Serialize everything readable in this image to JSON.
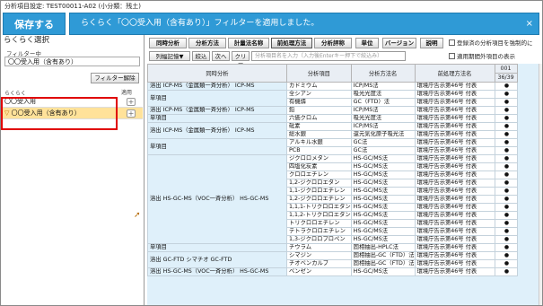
{
  "window_title": "分析項目設定: TEST00011-A02 (小分類：残土)",
  "save_label": "保存する",
  "banner_text": "らくらく「〇〇受入用（含有あり）」フィルターを適用しました。",
  "banner_close": "×",
  "left": {
    "heading": "らくらく選択",
    "filter_heading": "フィルター中",
    "filter_value": "〇〇受入用（含有あり）",
    "filter_clear_label": "フィルター解除",
    "list_heading": "らくらく",
    "apply_heading": "適用",
    "items": [
      {
        "label": "〇〇受入用",
        "prefix": ""
      },
      {
        "label": "〇〇受入用（含有あり）",
        "prefix": "▽"
      }
    ]
  },
  "tabs": [
    "同時分析",
    "分析方法",
    "計量法名称",
    "前処理方法",
    "分析評称",
    "単位",
    "バージョン",
    "説明"
  ],
  "options": {
    "sync_label": "登録済の分析項目を強制的に",
    "show_label": "適用期間外項目の表示"
  },
  "toolbar2": {
    "col_label": "列幅記憶",
    "col_arrow": "▼",
    "narrow": "絞込",
    "next": "次へ",
    "clear": "クリア",
    "search_placeholder": "分析項目名を入力（入力後Enterキー押下で絞込み）"
  },
  "table": {
    "headers": [
      "同時分析",
      "分析項目",
      "分析方法名",
      "前処理方法名",
      "001"
    ],
    "sub_header": "36/39",
    "rows": [
      {
        "group": "溶出 ICP-MS（金属類一斉分析） ICP-MS",
        "item": "カドミウム",
        "method": "ICP/MS法",
        "pre": "環境庁告示第46号 付表",
        "mark": "●"
      },
      {
        "group": "単項目",
        "item": "全シアン",
        "method": "吸光光度法",
        "pre": "環境庁告示第46号 付表",
        "mark": "●"
      },
      {
        "group": "",
        "item": "有機燐",
        "method": "GC（FTD）法",
        "pre": "環境庁告示第46号 付表",
        "mark": "●"
      },
      {
        "group": "溶出 ICP-MS（金属類一斉分析） ICP-MS",
        "item": "鉛",
        "method": "ICP/MS法",
        "pre": "環境庁告示第46号 付表",
        "mark": "●"
      },
      {
        "group": "単項目",
        "item": "六価クロム",
        "method": "吸光光度法",
        "pre": "環境庁告示第46号 付表",
        "mark": "●"
      },
      {
        "group": "溶出 ICP-MS（金属類一斉分析） ICP-MS",
        "item": "砒素",
        "method": "ICP/MS法",
        "pre": "環境庁告示第46号 付表",
        "mark": "●"
      },
      {
        "group": "",
        "item": "総水銀",
        "method": "還元気化原子吸光法",
        "pre": "環境庁告示第46号 付表",
        "mark": "●"
      },
      {
        "group": "単項目",
        "item": "アルキル水銀",
        "method": "GC法",
        "pre": "環境庁告示第46号 付表",
        "mark": "●"
      },
      {
        "group": "",
        "item": "PCB",
        "method": "GC法",
        "pre": "環境庁告示第46号 付表",
        "mark": "●"
      },
      {
        "group": "",
        "item": "ジクロロメタン",
        "method": "HS-GC/MS法",
        "pre": "環境庁告示第46号 付表",
        "mark": "●"
      },
      {
        "group": "",
        "item": "四塩化炭素",
        "method": "HS-GC/MS法",
        "pre": "環境庁告示第46号 付表",
        "mark": "●"
      },
      {
        "group": "",
        "item": "クロロエチレン",
        "method": "HS-GC/MS法",
        "pre": "環境庁告示第46号 付表",
        "mark": "●"
      },
      {
        "group": "",
        "item": "1,2-ジクロロエタン",
        "method": "HS-GC/MS法",
        "pre": "環境庁告示第46号 付表",
        "mark": "●"
      },
      {
        "group": "",
        "item": "1,1-ジクロロエチレン",
        "method": "HS-GC/MS法",
        "pre": "環境庁告示第46号 付表",
        "mark": "●"
      },
      {
        "group": "溶出 HS-GC-MS（VOC一斉分析） HS-GC-MS",
        "item": "1,2-ジクロロエチレン",
        "method": "HS-GC/MS法",
        "pre": "環境庁告示第46号 付表",
        "mark": "●"
      },
      {
        "group": "",
        "item": "1,1,1-トリクロロエタン",
        "method": "HS-GC/MS法",
        "pre": "環境庁告示第46号 付表",
        "mark": "●"
      },
      {
        "group": "",
        "item": "1,1,2-トリクロロエタン",
        "method": "HS-GC/MS法",
        "pre": "環境庁告示第46号 付表",
        "mark": "●"
      },
      {
        "group": "",
        "item": "トリクロロエチレン",
        "method": "HS-GC/MS法",
        "pre": "環境庁告示第46号 付表",
        "mark": "●"
      },
      {
        "group": "",
        "item": "テトラクロロエチレン",
        "method": "HS-GC/MS法",
        "pre": "環境庁告示第46号 付表",
        "mark": "●"
      },
      {
        "group": "",
        "item": "1,3-ジクロロプロペン",
        "method": "HS-GC/MS法",
        "pre": "環境庁告示第46号 付表",
        "mark": "●"
      },
      {
        "group": "単項目",
        "item": "チウラム",
        "method": "固相抽出-HPLC法",
        "pre": "環境庁告示第46号 付表",
        "mark": "●"
      },
      {
        "group": "溶出 GC-FTD シマチオ GC-FTD",
        "item": "シマジン",
        "method": "固相抽出-GC（FTD）法",
        "pre": "環境庁告示第46号 付表",
        "mark": "●"
      },
      {
        "group": "",
        "item": "チオベンカルブ",
        "method": "固相抽出-GC（FTD）法",
        "pre": "環境庁告示第46号 付表",
        "mark": "●"
      },
      {
        "group": "溶出 HS-GC-MS（VOC一斉分析） HS-GC-MS",
        "item": "ベンゼン",
        "method": "HS-GC/MS法",
        "pre": "環境庁告示第46号 付表",
        "mark": "●"
      }
    ]
  }
}
